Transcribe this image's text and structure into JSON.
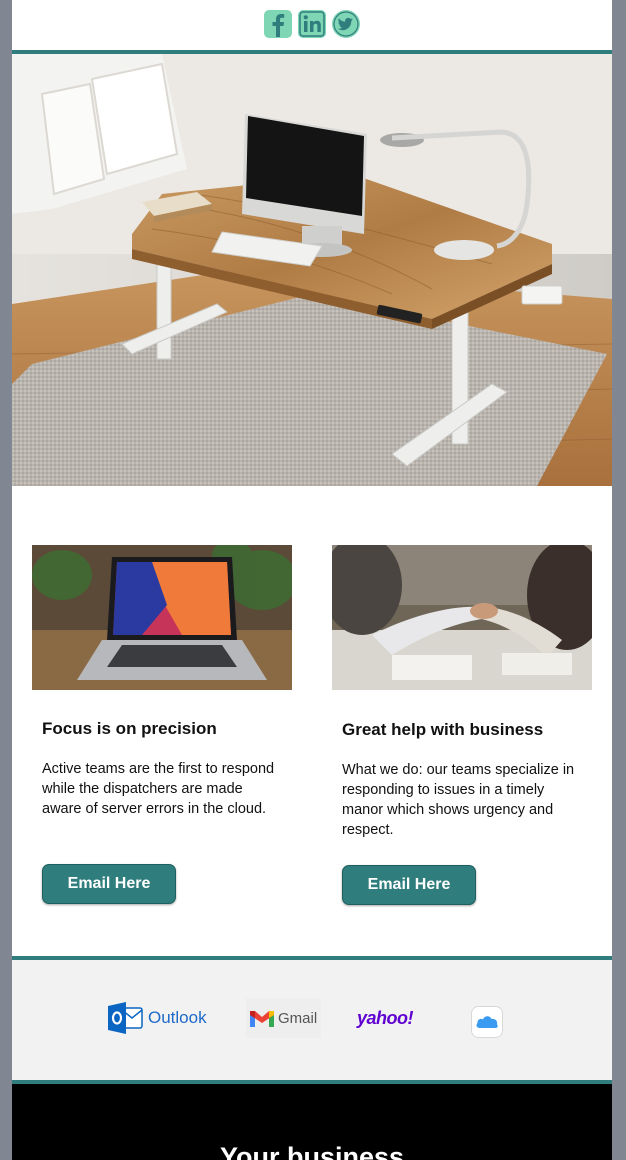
{
  "social": {
    "items": [
      {
        "name": "facebook-icon",
        "glyph": "f"
      },
      {
        "name": "linkedin-icon",
        "glyph": "in"
      },
      {
        "name": "twitter-icon",
        "glyph": ""
      }
    ]
  },
  "colors": {
    "accent": "#2f7d7d",
    "social_icon": "#7fd6b4",
    "page_background": "#808792",
    "footer_background": "#000000"
  },
  "cards": [
    {
      "title": "Focus is on precision",
      "body": "Active teams are the first to respond while the dispatchers are made aware of server errors in the cloud.",
      "button_label": "Email Here"
    },
    {
      "title": "Great help with business",
      "body": "What we do: our teams specialize in responding to issues in a timely manor which shows urgency and respect.",
      "button_label": "Email Here"
    }
  ],
  "providers": {
    "outlook_label": "Outlook",
    "gmail_label": "Gmail",
    "yahoo_label": "yahoo!",
    "icloud_icon": "icloud-icon"
  },
  "footer": {
    "title": "Your business"
  }
}
